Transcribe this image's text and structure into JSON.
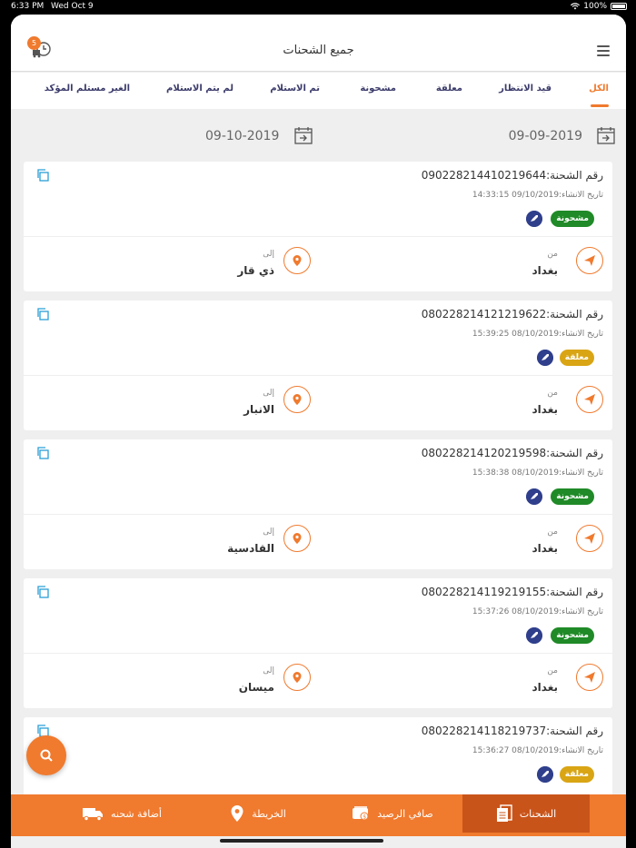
{
  "status_bar": {
    "time": "6:33 PM",
    "date": "Wed Oct 9",
    "battery": "100%"
  },
  "header": {
    "title": "جميع الشحنات",
    "notification_count": "5"
  },
  "tabs": [
    {
      "label": "الكل",
      "active": true
    },
    {
      "label": "قيد الانتظار",
      "active": false
    },
    {
      "label": "معلقة",
      "active": false
    },
    {
      "label": "مشحونة",
      "active": false
    },
    {
      "label": "تم الاستلام",
      "active": false
    },
    {
      "label": "لم يتم الاستلام",
      "active": false
    },
    {
      "label": "الغير مستلم المؤكد",
      "active": false
    }
  ],
  "date_range": {
    "from": "09-09-2019",
    "to": "09-10-2019"
  },
  "shipments": [
    {
      "number": "رقم الشحنة:090228214410219644",
      "created": "تاريخ الانشاء:09/10/2019 14:33:15",
      "status": "مشحونة",
      "status_color": "#1f8a27",
      "from_label": "من",
      "from_city": "بغداد",
      "to_label": "إلى",
      "to_city": "ذي قار"
    },
    {
      "number": "رقم الشحنة:080228214121219622",
      "created": "تاريخ الانشاء:08/10/2019 15:39:25",
      "status": "معلقة",
      "status_color": "#d9a514",
      "from_label": "من",
      "from_city": "بغداد",
      "to_label": "إلى",
      "to_city": "الانبار"
    },
    {
      "number": "رقم الشحنة:080228214120219598",
      "created": "تاريخ الانشاء:08/10/2019 15:38:38",
      "status": "مشحونة",
      "status_color": "#1f8a27",
      "from_label": "من",
      "from_city": "بغداد",
      "to_label": "إلى",
      "to_city": "القادسية"
    },
    {
      "number": "رقم الشحنة:080228214119219155",
      "created": "تاريخ الانشاء:08/10/2019 15:37:26",
      "status": "مشحونة",
      "status_color": "#1f8a27",
      "from_label": "من",
      "from_city": "بغداد",
      "to_label": "إلى",
      "to_city": "ميسان"
    },
    {
      "number": "رقم الشحنة:080228214118219737",
      "created": "تاريخ الانشاء:08/10/2019 15:36:27",
      "status": "معلقة",
      "status_color": "#d9a514"
    }
  ],
  "bottom_nav": [
    {
      "label": "الشحنات",
      "icon": "document-icon",
      "active": true
    },
    {
      "label": "صافي الرصيد",
      "icon": "wallet-icon",
      "active": false
    },
    {
      "label": "الخريطة",
      "icon": "map-pin-icon",
      "active": false
    },
    {
      "label": "أضافة شحنه",
      "icon": "truck-icon",
      "active": false
    }
  ],
  "colors": {
    "accent": "#f07a2e",
    "tab_text": "#3b3b6b",
    "rocket": "#2f3f8c"
  }
}
